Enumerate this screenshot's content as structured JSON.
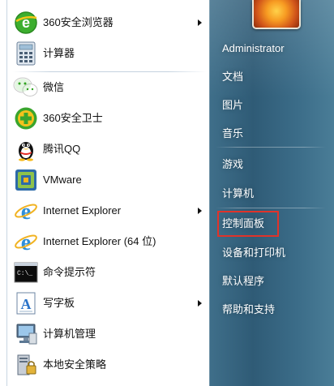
{
  "left_menu": {
    "items": [
      {
        "label": "360安全浏览器",
        "icon": "360-browser-icon",
        "has_arrow": true
      },
      {
        "label": "计算器",
        "icon": "calculator-icon",
        "has_arrow": false
      },
      {
        "label": "微信",
        "icon": "wechat-icon",
        "has_arrow": false
      },
      {
        "label": "360安全卫士",
        "icon": "360-security-icon",
        "has_arrow": false
      },
      {
        "label": "腾讯QQ",
        "icon": "qq-penguin-icon",
        "has_arrow": false
      },
      {
        "label": "VMware",
        "icon": "vmware-icon",
        "has_arrow": false
      },
      {
        "label": "Internet Explorer",
        "icon": "internet-explorer-icon",
        "has_arrow": true
      },
      {
        "label": "Internet Explorer (64 位)",
        "icon": "internet-explorer-icon",
        "has_arrow": false
      },
      {
        "label": "命令提示符",
        "icon": "command-prompt-icon",
        "has_arrow": false
      },
      {
        "label": "写字板",
        "icon": "wordpad-icon",
        "has_arrow": true
      },
      {
        "label": "计算机管理",
        "icon": "computer-management-icon",
        "has_arrow": false
      },
      {
        "label": "本地安全策略",
        "icon": "security-policy-icon",
        "has_arrow": false
      }
    ]
  },
  "right_menu": {
    "user": "Administrator",
    "items": [
      {
        "label": "文档"
      },
      {
        "label": "图片"
      },
      {
        "label": "音乐"
      },
      {
        "label": "游戏"
      },
      {
        "label": "计算机"
      },
      {
        "label": "控制面板",
        "highlighted": true
      },
      {
        "label": "设备和打印机"
      },
      {
        "label": "默认程序"
      },
      {
        "label": "帮助和支持"
      }
    ]
  },
  "colors": {
    "highlight_border": "#e0332a",
    "right_pane": "#2f5b76"
  }
}
